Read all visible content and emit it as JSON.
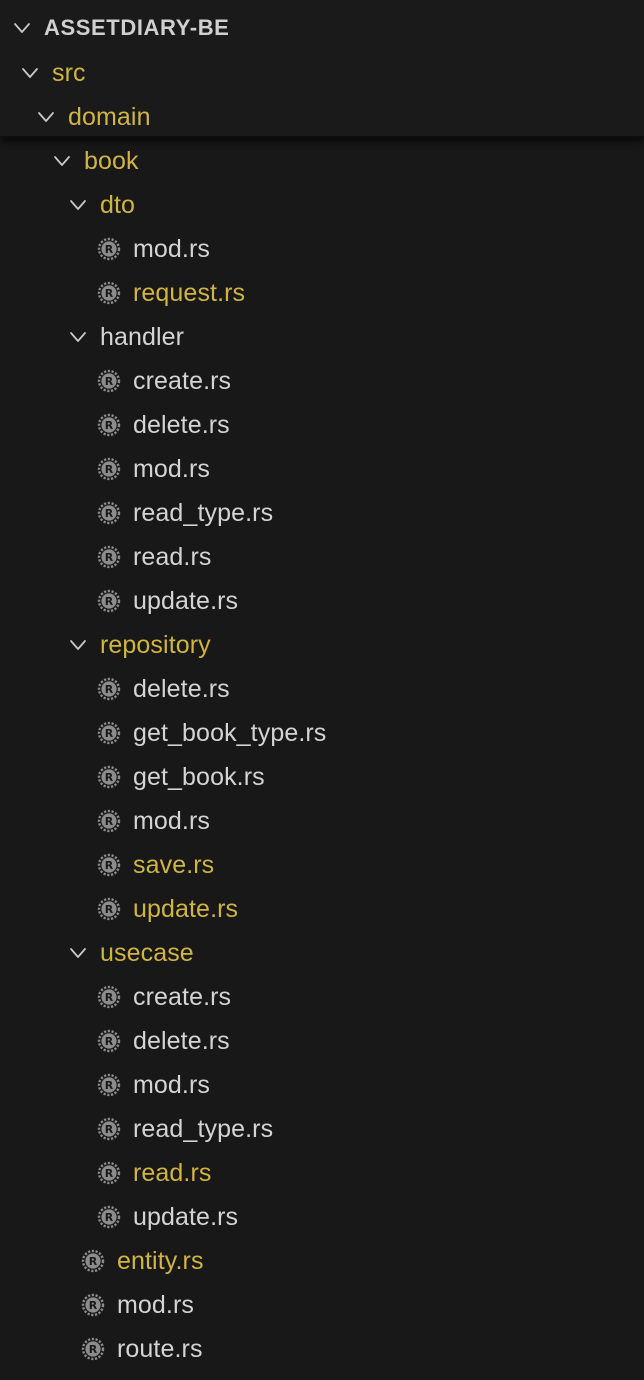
{
  "explorer": {
    "project": "ASSETDIARY-BE",
    "colors": {
      "background": "#181818",
      "text": "#d4d4d4",
      "modified": "#d1b540",
      "icon": "#8c8c8c"
    },
    "items": [
      {
        "label": "src",
        "type": "folder",
        "depth": 1,
        "modified": true
      },
      {
        "label": "domain",
        "type": "folder",
        "depth": 2,
        "modified": true
      },
      {
        "label": "book",
        "type": "folder",
        "depth": 3,
        "modified": true
      },
      {
        "label": "dto",
        "type": "folder",
        "depth": 4,
        "modified": true
      },
      {
        "label": "mod.rs",
        "type": "file",
        "depth": 5,
        "modified": false
      },
      {
        "label": "request.rs",
        "type": "file",
        "depth": 5,
        "modified": true
      },
      {
        "label": "handler",
        "type": "folder",
        "depth": 4,
        "modified": false
      },
      {
        "label": "create.rs",
        "type": "file",
        "depth": 5,
        "modified": false
      },
      {
        "label": "delete.rs",
        "type": "file",
        "depth": 5,
        "modified": false
      },
      {
        "label": "mod.rs",
        "type": "file",
        "depth": 5,
        "modified": false
      },
      {
        "label": "read_type.rs",
        "type": "file",
        "depth": 5,
        "modified": false
      },
      {
        "label": "read.rs",
        "type": "file",
        "depth": 5,
        "modified": false
      },
      {
        "label": "update.rs",
        "type": "file",
        "depth": 5,
        "modified": false
      },
      {
        "label": "repository",
        "type": "folder",
        "depth": 4,
        "modified": true
      },
      {
        "label": "delete.rs",
        "type": "file",
        "depth": 5,
        "modified": false
      },
      {
        "label": "get_book_type.rs",
        "type": "file",
        "depth": 5,
        "modified": false
      },
      {
        "label": "get_book.rs",
        "type": "file",
        "depth": 5,
        "modified": false
      },
      {
        "label": "mod.rs",
        "type": "file",
        "depth": 5,
        "modified": false
      },
      {
        "label": "save.rs",
        "type": "file",
        "depth": 5,
        "modified": true
      },
      {
        "label": "update.rs",
        "type": "file",
        "depth": 5,
        "modified": true
      },
      {
        "label": "usecase",
        "type": "folder",
        "depth": 4,
        "modified": true
      },
      {
        "label": "create.rs",
        "type": "file",
        "depth": 5,
        "modified": false
      },
      {
        "label": "delete.rs",
        "type": "file",
        "depth": 5,
        "modified": false
      },
      {
        "label": "mod.rs",
        "type": "file",
        "depth": 5,
        "modified": false
      },
      {
        "label": "read_type.rs",
        "type": "file",
        "depth": 5,
        "modified": false
      },
      {
        "label": "read.rs",
        "type": "file",
        "depth": 5,
        "modified": true
      },
      {
        "label": "update.rs",
        "type": "file",
        "depth": 5,
        "modified": false
      },
      {
        "label": "entity.rs",
        "type": "file",
        "depth": 4,
        "modified": true
      },
      {
        "label": "mod.rs",
        "type": "file",
        "depth": 4,
        "modified": false
      },
      {
        "label": "route.rs",
        "type": "file",
        "depth": 4,
        "modified": false
      }
    ]
  }
}
